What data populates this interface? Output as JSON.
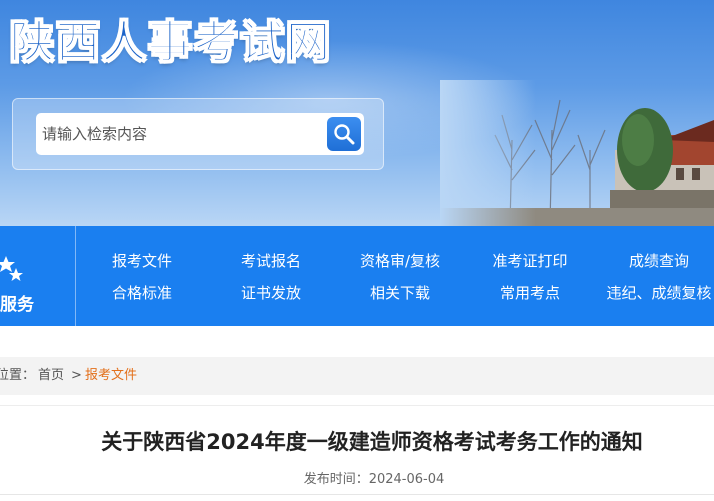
{
  "header": {
    "site_title": "陕西人事考试网",
    "search": {
      "placeholder": "请输入检索内容",
      "value": ""
    }
  },
  "navbar": {
    "service_label": "服务",
    "row1": [
      "报考文件",
      "考试报名",
      "资格审/复核",
      "准考证打印",
      "成绩查询"
    ],
    "row2": [
      "合格标准",
      "证书发放",
      "相关下载",
      "常用考点",
      "违纪、成绩复核"
    ]
  },
  "breadcrumb": {
    "prefix": "位置：",
    "home": "首页",
    "separator": ">",
    "current": "报考文件"
  },
  "article": {
    "title": "关于陕西省2024年度一级建造师资格考试考务工作的通知",
    "date_label": "发布时间：",
    "date": "2024-06-04"
  },
  "colors": {
    "nav_bg": "#1a7ff0",
    "title_blue": "#1d64c9",
    "breadcrumb_current": "#e3701b"
  },
  "icons": {
    "search": "magnifier-icon",
    "service": "stars-icon"
  }
}
